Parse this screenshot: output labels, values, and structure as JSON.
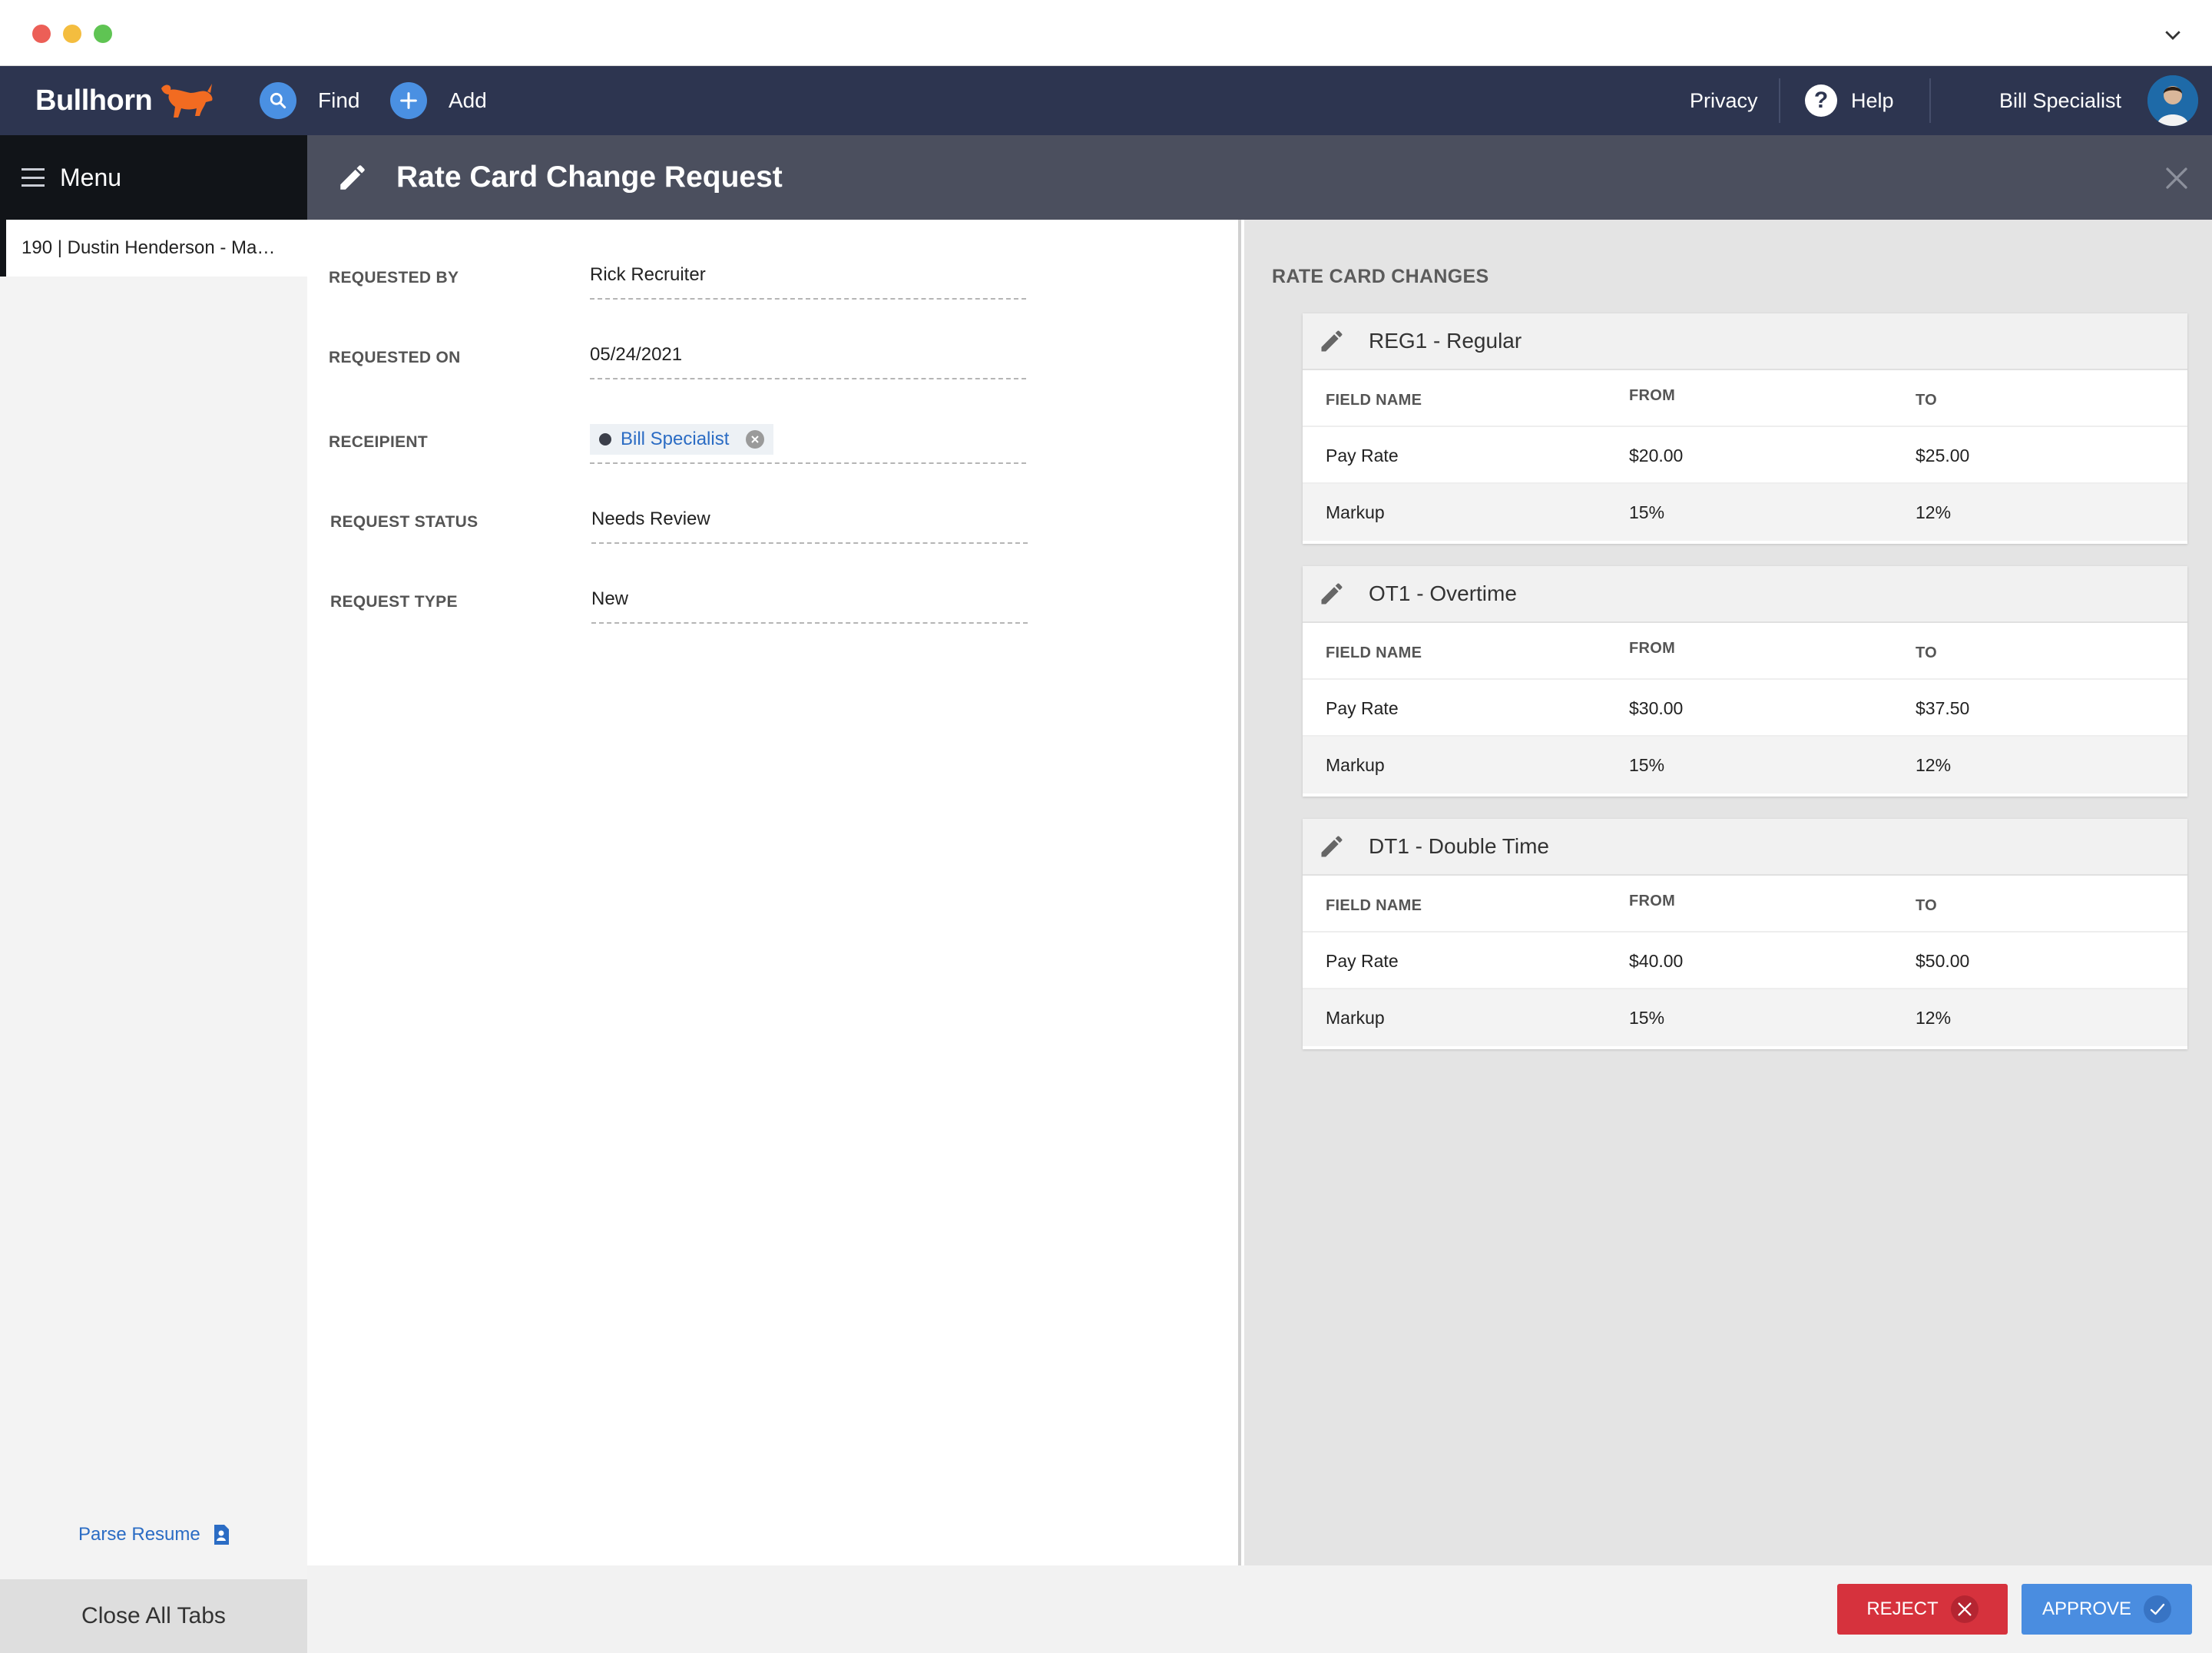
{
  "nav": {
    "logo": "Bullhorn",
    "find_label": "Find",
    "add_label": "Add",
    "privacy_label": "Privacy",
    "help_label": "Help",
    "help_glyph": "?",
    "user_name": "Bill Specialist"
  },
  "sidebar": {
    "menu_label": "Menu",
    "tab_label": "190 | Dustin Henderson - Ma…",
    "parse_resume_label": "Parse Resume",
    "close_all_label": "Close All Tabs"
  },
  "header": {
    "title": "Rate Card Change Request"
  },
  "form": {
    "requested_by": {
      "label": "REQUESTED BY",
      "value": "Rick Recruiter"
    },
    "requested_on": {
      "label": "REQUESTED ON",
      "value": "05/24/2021"
    },
    "recipient": {
      "label": "RECEIPIENT",
      "value": "Bill Specialist"
    },
    "request_status": {
      "label": "REQUEST STATUS",
      "value": "Needs Review"
    },
    "request_type": {
      "label": "REQUEST TYPE",
      "value": "New"
    }
  },
  "rate_changes": {
    "title": "RATE CARD CHANGES",
    "columns": [
      "FIELD NAME",
      "FROM",
      "TO"
    ],
    "cards": [
      {
        "title": "REG1 - Regular",
        "rows": [
          {
            "field": "Pay Rate",
            "from": "$20.00",
            "to": "$25.00"
          },
          {
            "field": "Markup",
            "from": "15%",
            "to": "12%"
          }
        ]
      },
      {
        "title": "OT1 - Overtime",
        "rows": [
          {
            "field": "Pay Rate",
            "from": "$30.00",
            "to": "$37.50"
          },
          {
            "field": "Markup",
            "from": "15%",
            "to": "12%"
          }
        ]
      },
      {
        "title": "DT1 - Double Time",
        "rows": [
          {
            "field": "Pay Rate",
            "from": "$40.00",
            "to": "$50.00"
          },
          {
            "field": "Markup",
            "from": "15%",
            "to": "12%"
          }
        ]
      }
    ]
  },
  "footer": {
    "reject_label": "REJECT",
    "approve_label": "APPROVE"
  },
  "colors": {
    "nav_bg": "#2d3550",
    "header_bg": "#4b4f5e",
    "accent_blue": "#4a8de0",
    "reject_red": "#d6323d",
    "link_blue": "#2b6cc4",
    "logo_orange": "#f26b21"
  },
  "icons": {
    "find": "search-icon",
    "add": "plus-icon",
    "help": "help-icon",
    "menu": "hamburger-icon",
    "edit": "pencil-icon",
    "close": "close-icon",
    "parse_resume": "document-person-icon",
    "reject": "x-icon",
    "approve": "check-icon"
  }
}
